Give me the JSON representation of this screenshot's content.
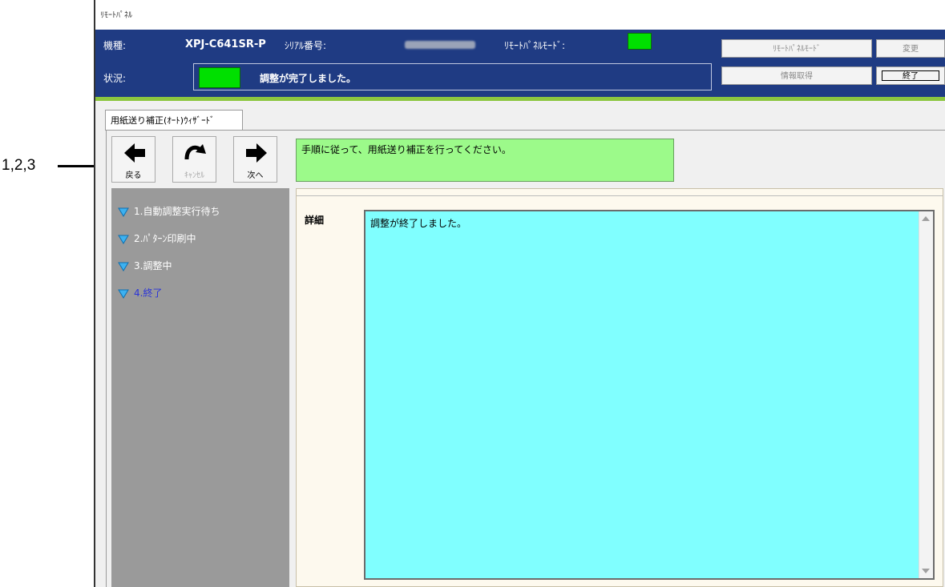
{
  "callout": "1,2,3",
  "window": {
    "title": "ﾘﾓｰﾄﾊﾟﾈﾙ"
  },
  "header": {
    "model_label": "機種:",
    "model_value": "XPJ-C641SR-P",
    "serial_label": "ｼﾘｱﾙ番号:",
    "remote_mode_label": "ﾘﾓｰﾄﾊﾟﾈﾙﾓｰﾄﾞ:",
    "status_label": "状況:",
    "status_text": "調整が完了しました。",
    "buttons": {
      "remote_panel_mode": "ﾘﾓｰﾄﾊﾟﾈﾙﾓｰﾄﾞ",
      "change": "変更",
      "get_info": "情報取得",
      "exit": "終了"
    }
  },
  "tab": {
    "label": "用紙送り補正(ｵｰﾄ)ｳｨｻﾞｰﾄﾞ"
  },
  "toolbar": {
    "back": "戻る",
    "cancel": "ｷｬﾝｾﾙ",
    "next": "次へ"
  },
  "instruction": "手順に従って、用紙送り補正を行ってください。",
  "steps": [
    {
      "label": "1.自動調整実行待ち",
      "current": false
    },
    {
      "label": "2.ﾊﾟﾀｰﾝ印刷中",
      "current": false
    },
    {
      "label": "3.調整中",
      "current": false
    },
    {
      "label": "4.終了",
      "current": true
    }
  ],
  "details": {
    "label": "詳細",
    "text": "調整が終了しました。"
  },
  "colors": {
    "header_bg": "#1f3b83",
    "led_green": "#00e000",
    "instruction_bg": "#9cfa8a",
    "details_bg": "#80ffff",
    "steps_bg": "#9a9a9a",
    "current_step": "#2b34d8",
    "accent_stripe": "#8cc63f"
  },
  "icons": {
    "back": "arrow-left-icon",
    "cancel": "curved-arrow-icon",
    "next": "arrow-right-icon",
    "step": "triangle-down-icon"
  }
}
